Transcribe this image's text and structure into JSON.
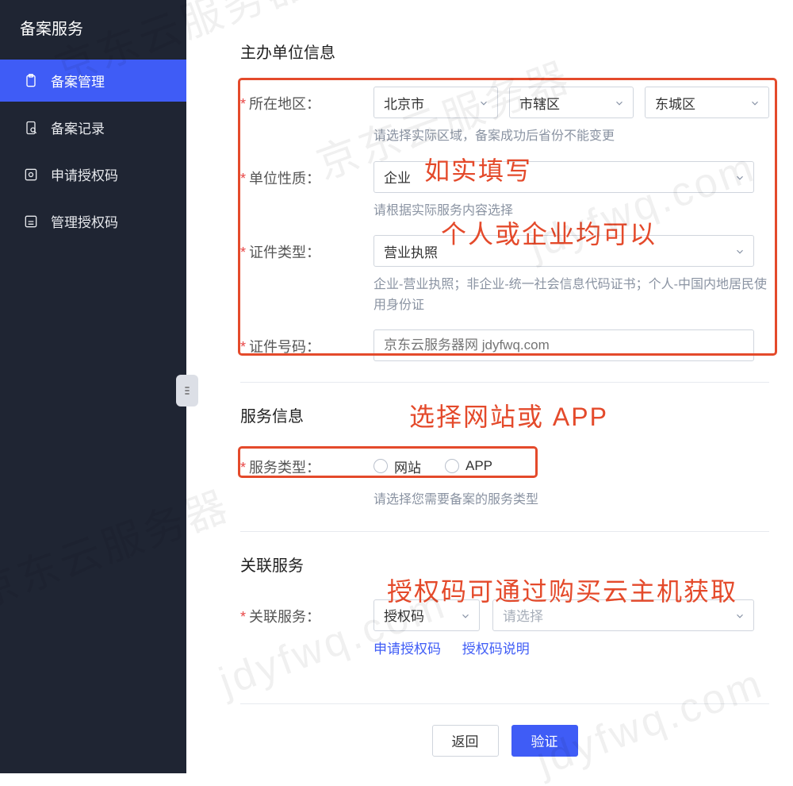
{
  "sidebar": {
    "title": "备案服务",
    "items": [
      {
        "label": "备案管理",
        "active": true
      },
      {
        "label": "备案记录"
      },
      {
        "label": "申请授权码"
      },
      {
        "label": "管理授权码"
      }
    ]
  },
  "sections": {
    "org": {
      "title": "主办单位信息",
      "region": {
        "label": "所在地区：",
        "prov": "北京市",
        "city": "市辖区",
        "dist": "东城区",
        "hint": "请选择实际区域，备案成功后省份不能变更"
      },
      "nature": {
        "label": "单位性质：",
        "value": "企业",
        "hint": "请根据实际服务内容选择"
      },
      "certType": {
        "label": "证件类型：",
        "value": "营业执照",
        "hint": "企业-营业执照；非企业-统一社会信息代码证书；个人-中国内地居民使用身份证"
      },
      "certNo": {
        "label": "证件号码：",
        "placeholder": "京东云服务器网 jdyfwq.com"
      }
    },
    "service": {
      "title": "服务信息",
      "type": {
        "label": "服务类型：",
        "opt1": "网站",
        "opt2": "APP",
        "hint": "请选择您需要备案的服务类型"
      }
    },
    "assoc": {
      "title": "关联服务",
      "label": "关联服务：",
      "code": "授权码",
      "placeholder": "请选择",
      "links": {
        "apply": "申请授权码",
        "desc": "授权码说明"
      }
    }
  },
  "buttons": {
    "back": "返回",
    "verify": "验证"
  },
  "annotations": {
    "fill": "如实填写",
    "either": "个人或企业均可以",
    "chooseSvc": "选择网站或 APP",
    "authHint": "授权码可通过购买云主机获取"
  },
  "watermark": {
    "cn": "京东云服务器",
    "en": "jdyfwq.com"
  }
}
